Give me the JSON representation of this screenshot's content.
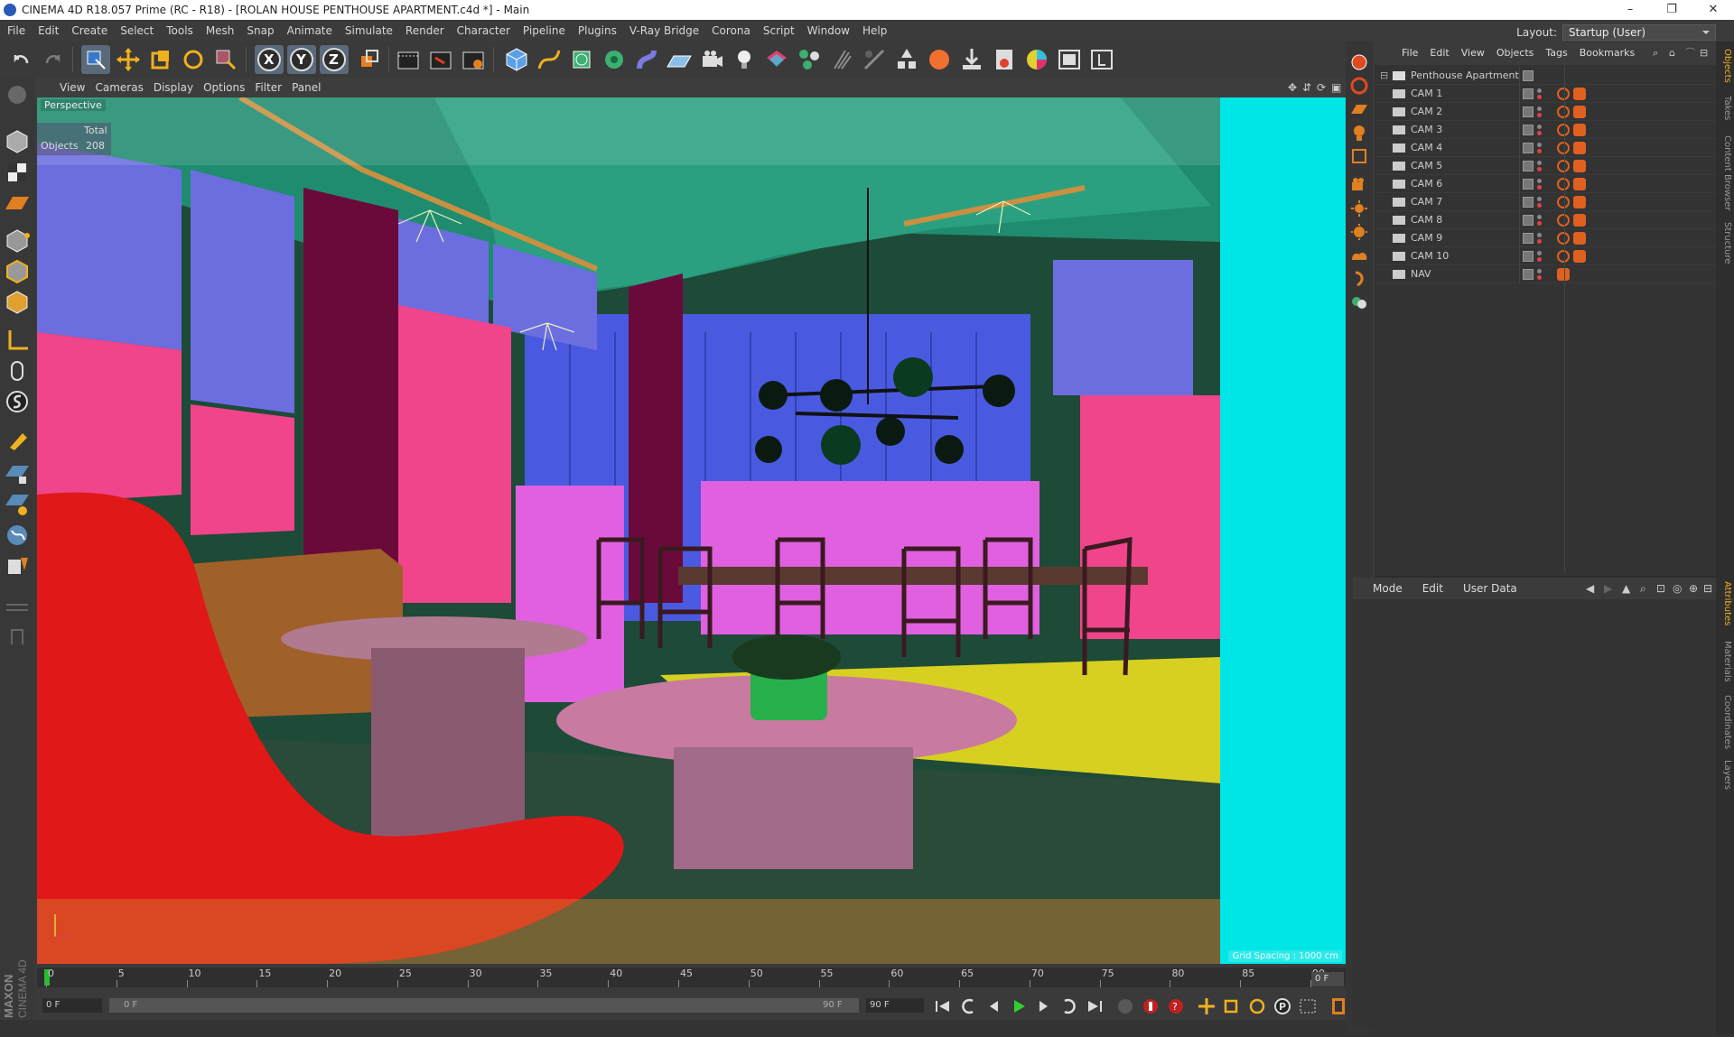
{
  "window": {
    "title": "CINEMA 4D R18.057 Prime (RC - R18) - [ROLAN HOUSE PENTHOUSE APARTMENT.c4d *] - Main",
    "minimize": "–",
    "maximize": "❐",
    "close": "✕"
  },
  "menubar": {
    "items": [
      "File",
      "Edit",
      "Create",
      "Select",
      "Tools",
      "Mesh",
      "Snap",
      "Animate",
      "Simulate",
      "Render",
      "Character",
      "Pipeline",
      "Plugins",
      "V-Ray Bridge",
      "Corona",
      "Script",
      "Window",
      "Help"
    ],
    "layout_label": "Layout:",
    "layout_value": "Startup (User)"
  },
  "toolbar": {
    "axis_x": "X",
    "axis_y": "Y",
    "axis_z": "Z"
  },
  "viewport": {
    "menu": [
      "View",
      "Cameras",
      "Display",
      "Options",
      "Filter",
      "Panel"
    ],
    "label": "Perspective",
    "stats_total_label": "Total",
    "stats_objects_label": "Objects",
    "stats_objects_value": "208",
    "grid_spacing": "Grid Spacing : 1000 cm",
    "colors": {
      "ceiling": "#1f8c70",
      "panel_blue": "#6c6ee0",
      "pink_wall": "#f0458a",
      "magenta": "#e060e0",
      "cyan": "#00e5e5",
      "yellow": "#d8d020",
      "chair_red": "#e01818",
      "table_pink": "#c87aa0",
      "floor": "#2a4a3a"
    }
  },
  "timeline": {
    "ticks": [
      "0",
      "5",
      "10",
      "15",
      "20",
      "25",
      "30",
      "35",
      "40",
      "45",
      "50",
      "55",
      "60",
      "65",
      "70",
      "75",
      "80",
      "85",
      "90"
    ],
    "current_frame": "0 F"
  },
  "transport": {
    "start_field": "0 F",
    "range_start": "0 F",
    "range_end": "90 F",
    "end_field": "90 F"
  },
  "objects_panel": {
    "menu": [
      "File",
      "Edit",
      "View",
      "Objects",
      "Tags",
      "Bookmarks"
    ],
    "root": "Penthouse Apartment",
    "items": [
      "CAM 1",
      "CAM 2",
      "CAM 3",
      "CAM 4",
      "CAM 5",
      "CAM 6",
      "CAM 7",
      "CAM 8",
      "CAM 9",
      "CAM 10",
      "NAV"
    ]
  },
  "attributes_panel": {
    "menu": [
      "Mode",
      "Edit",
      "User Data"
    ]
  },
  "side_tabs": [
    "Objects",
    "Takes",
    "Content Browser",
    "Structure",
    "Attributes",
    "Materials",
    "Coordinates",
    "Layers"
  ],
  "brand": {
    "line1": "MAXON",
    "line2": "CINEMA 4D"
  }
}
